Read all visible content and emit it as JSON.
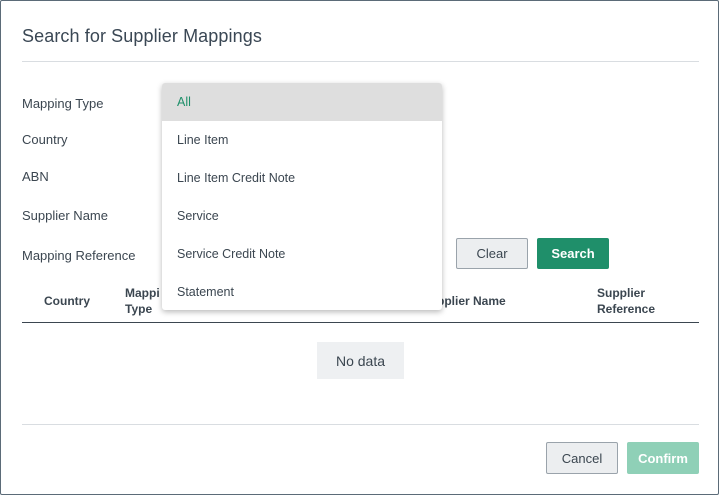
{
  "dialog": {
    "title": "Search for Supplier Mappings"
  },
  "form": {
    "mapping_type_label": "Mapping Type",
    "country_label": "Country",
    "abn_label": "ABN",
    "supplier_name_label": "Supplier Name",
    "mapping_reference_label": "Mapping Reference",
    "clear_label": "Clear",
    "search_label": "Search"
  },
  "dropdown": {
    "options": [
      "All",
      "Line Item",
      "Line Item Credit Note",
      "Service",
      "Service Credit Note",
      "Statement"
    ],
    "selected": "All"
  },
  "table": {
    "headers": {
      "country": "Country",
      "mapping_type_line1": "Mappi",
      "mapping_type_line2": "Type",
      "supplier_name": "pplier Name",
      "supplier_reference_line1": "Supplier",
      "supplier_reference_line2": "Reference"
    },
    "empty_text": "No data"
  },
  "footer": {
    "cancel_label": "Cancel",
    "confirm_label": "Confirm"
  },
  "colors": {
    "accent": "#1f8f6a",
    "accent_disabled": "#8fd0b7",
    "text": "#3b4650",
    "selected_bg": "#dedede"
  }
}
